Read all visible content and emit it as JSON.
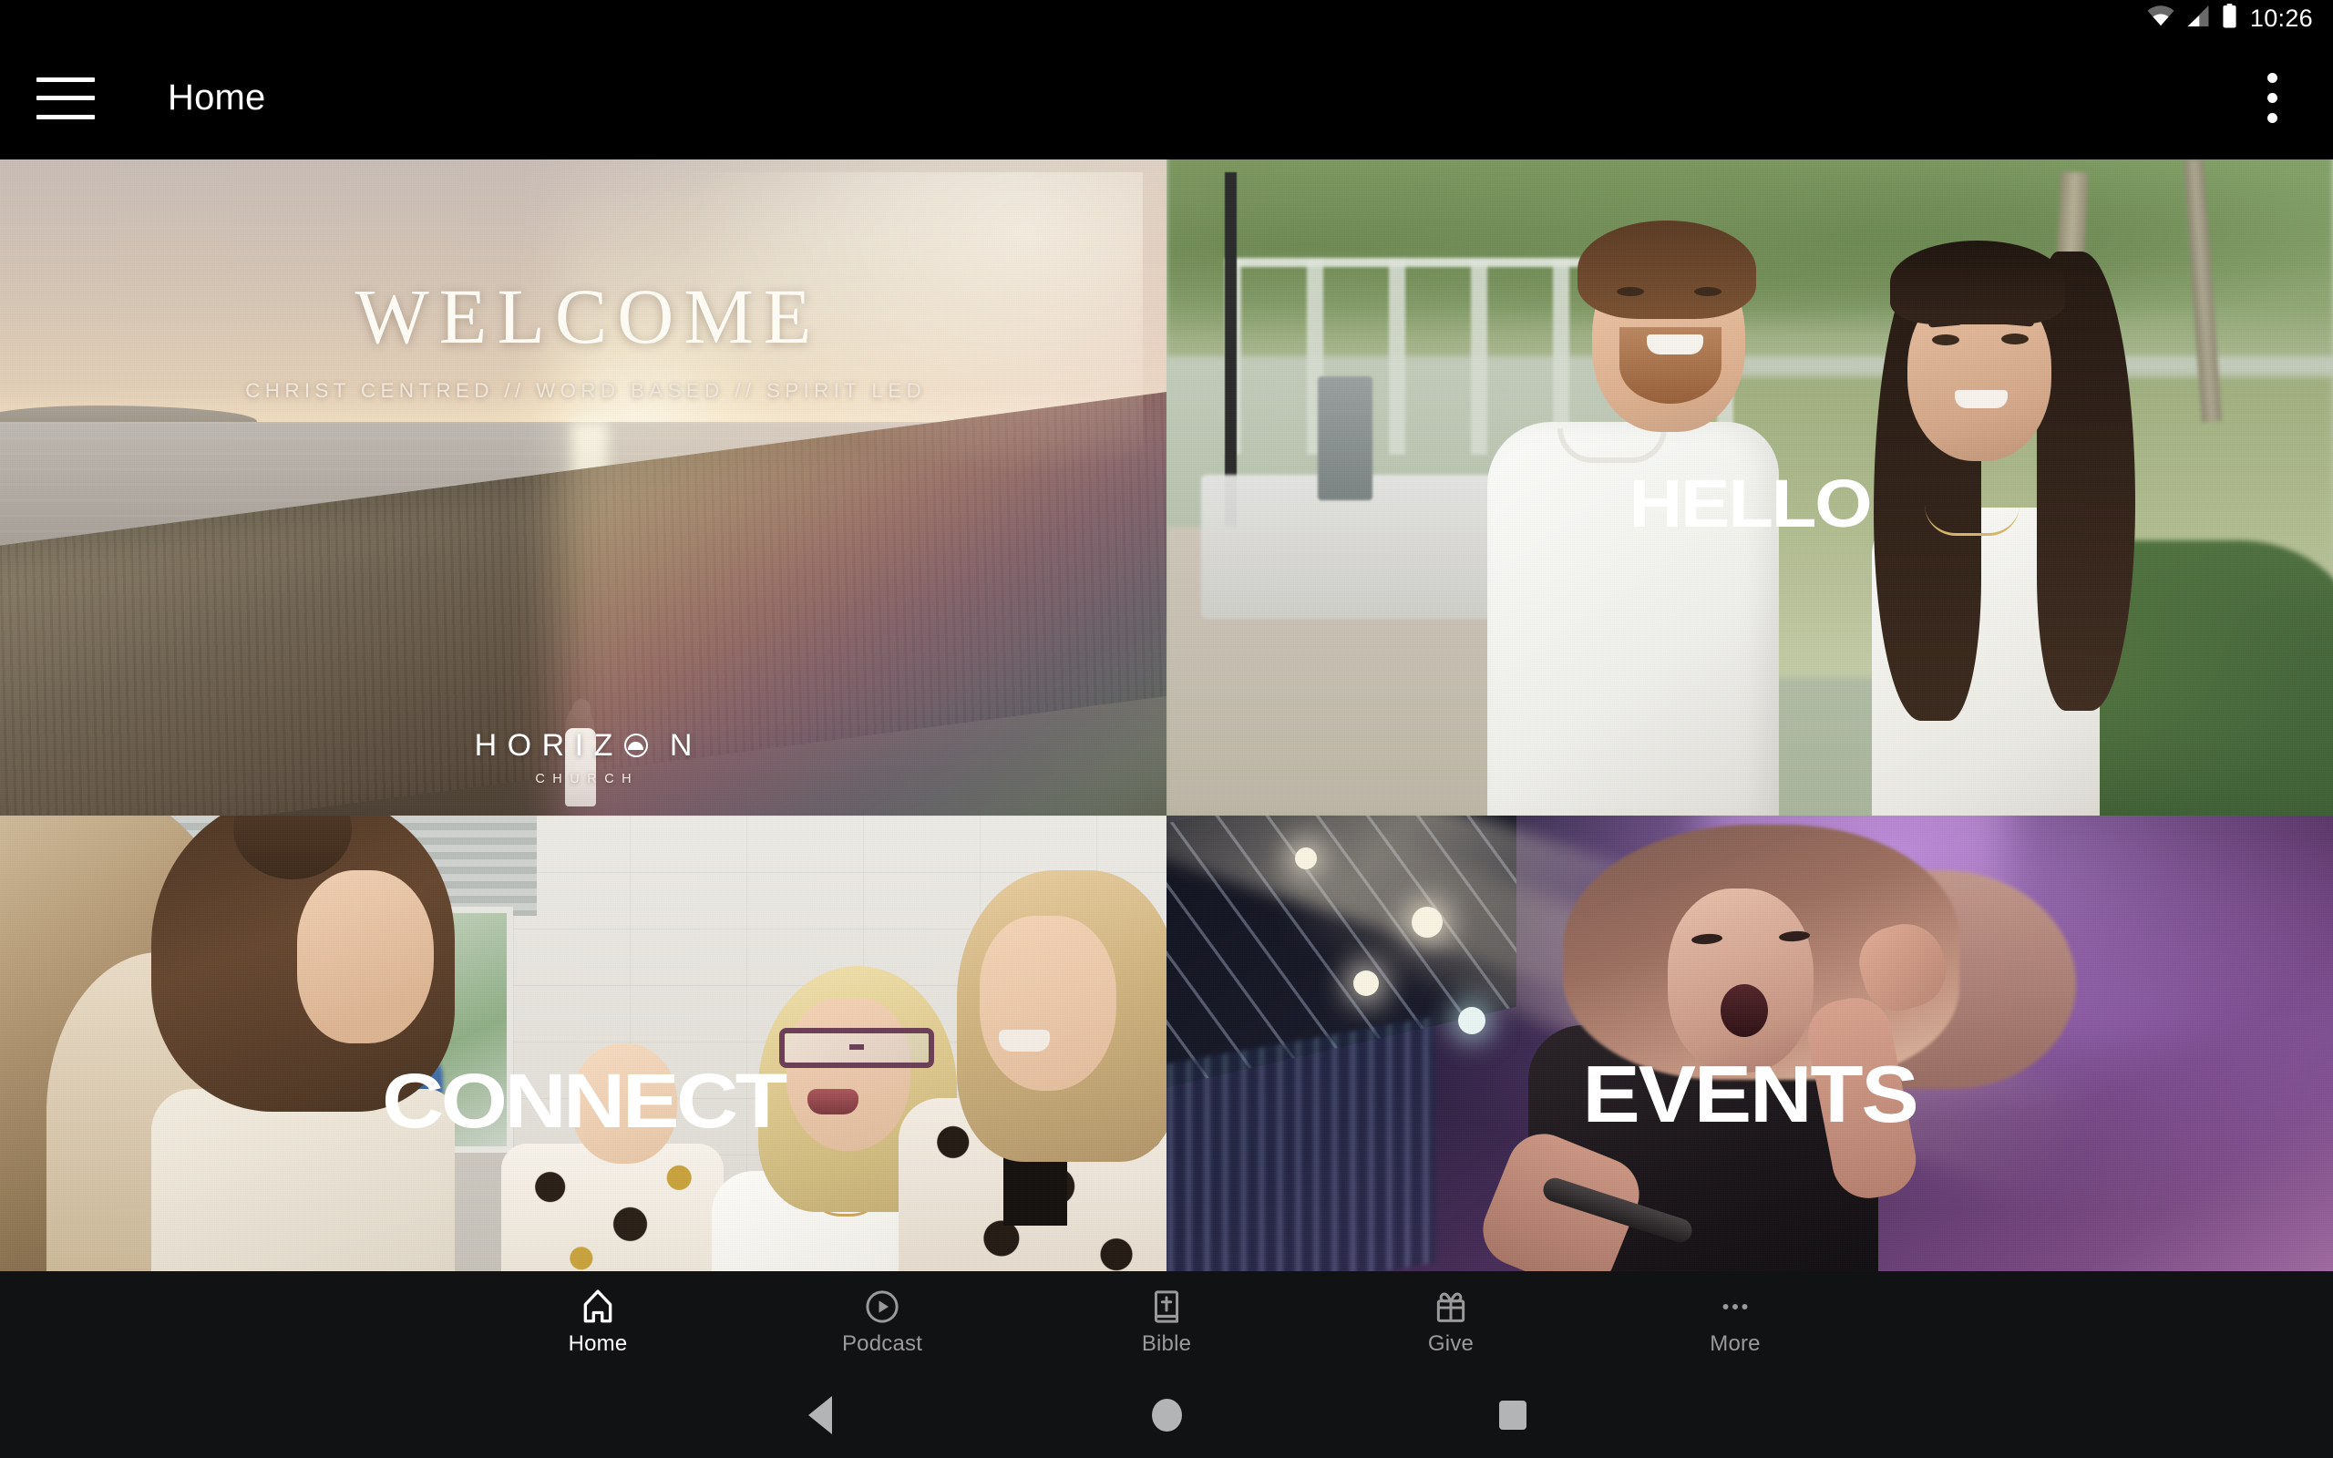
{
  "status_bar": {
    "time": "10:26",
    "icons": [
      "wifi-icon",
      "cellular-signal-icon",
      "battery-icon"
    ]
  },
  "app_bar": {
    "menu_icon": "hamburger-menu-icon",
    "title": "Home",
    "overflow_icon": "more-vertical-icon"
  },
  "tiles": [
    {
      "id": "welcome",
      "label": "WELCOME",
      "subtitle": "CHRIST CENTRED // WORD BASED // SPIRIT LED",
      "logo_word": "H O R I Z N",
      "logo_pre": "HORIZ",
      "logo_post": "N",
      "logo_sub": "CHURCH",
      "scene": "beach sunset with person on dune"
    },
    {
      "id": "hello",
      "label": "HELLO",
      "scene": "smiling couple in a park"
    },
    {
      "id": "connect",
      "label": "CONNECT",
      "scene": "group of women talking"
    },
    {
      "id": "events",
      "label": "EVENTS",
      "scene": "worship singer on stage under purple lights"
    }
  ],
  "bottom_nav": {
    "active": "Home",
    "items": [
      {
        "label": "Home",
        "icon": "church-home-icon",
        "active": true
      },
      {
        "label": "Podcast",
        "icon": "play-circle-icon",
        "active": false
      },
      {
        "label": "Bible",
        "icon": "bible-book-icon",
        "active": false
      },
      {
        "label": "Give",
        "icon": "gift-icon",
        "active": false
      },
      {
        "label": "More",
        "icon": "more-horizontal-icon",
        "active": false
      }
    ]
  },
  "system_nav": {
    "back": "back-triangle-icon",
    "home": "home-circle-icon",
    "recents": "recents-square-icon"
  },
  "colors": {
    "app_bar_bg": "#000000",
    "nav_bg": "#111214",
    "active_label": "#ffffff",
    "inactive_label": "#9a9a9a"
  }
}
